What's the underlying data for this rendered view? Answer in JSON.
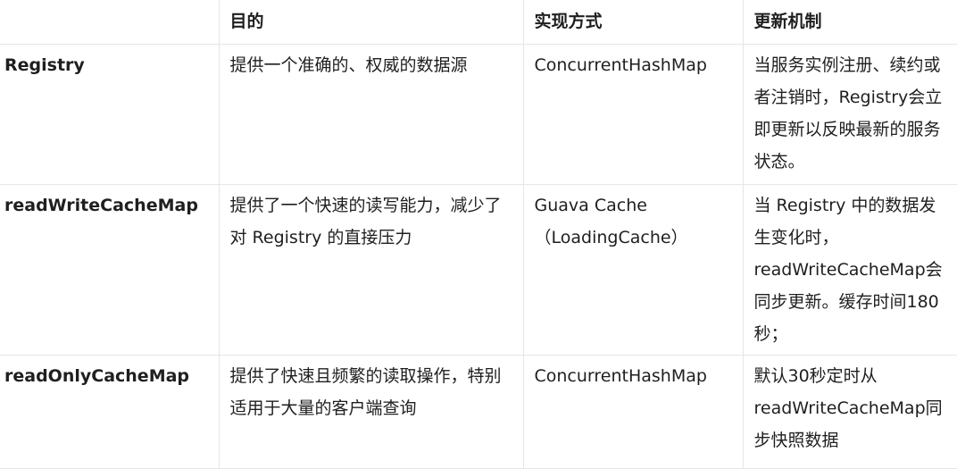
{
  "table": {
    "headers": [
      "",
      "目的",
      "实现方式",
      "更新机制"
    ],
    "rows": [
      {
        "name": "Registry",
        "purpose": "提供一个准确的、权威的数据源",
        "implementation": "ConcurrentHashMap",
        "update": "当服务实例注册、续约或者注销时，Registry会立即更新以反映最新的服务状态。"
      },
      {
        "name": "readWriteCacheMap",
        "purpose": "提供了一个快速的读写能力，减少了对 Registry 的直接压力",
        "implementation": "Guava Cache\n（LoadingCache）",
        "update": "当 Registry 中的数据发生变化时，readWriteCacheMap会同步更新。缓存时间180秒；"
      },
      {
        "name": "readOnlyCacheMap",
        "purpose": "提供了快速且频繁的读取操作，特别适用于大量的客户端查询",
        "implementation": "ConcurrentHashMap",
        "update": "默认30秒定时从readWriteCacheMap同步快照数据"
      }
    ]
  }
}
